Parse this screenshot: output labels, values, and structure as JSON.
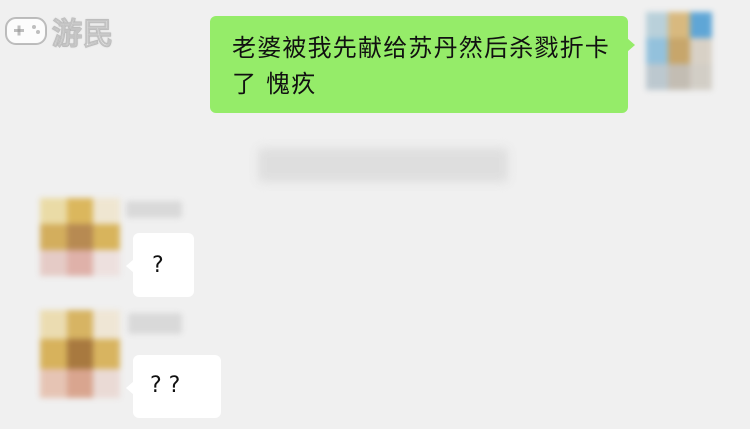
{
  "watermark": {
    "text": "游民",
    "icon": "gamepad-icon"
  },
  "colors": {
    "background": "#f0f0f0",
    "outgoing_bubble": "#95ec69",
    "incoming_bubble": "#ffffff"
  },
  "messages": [
    {
      "sender": "self",
      "text": "老婆被我先献给苏丹然后杀戮折卡了 愧疚",
      "avatar_mosaic": [
        "#b9d0da",
        "#d8b97f",
        "#5fa6d6",
        "#93c1dc",
        "#c7a66b",
        "#d8d1c6",
        "#bcc8cf",
        "#c3bdb3",
        "#d2cec6"
      ]
    },
    {
      "sender": "other",
      "text": "?",
      "avatar_mosaic": [
        "#eadba6",
        "#dbb75d",
        "#efe6d1",
        "#d3ae5d",
        "#b78a52",
        "#d8b45c",
        "#e5cbc6",
        "#dfb1a9",
        "#ede0de"
      ]
    },
    {
      "sender": "other",
      "text": "? ?",
      "avatar_mosaic": [
        "#ebdcb1",
        "#d7b463",
        "#efe6d5",
        "#d7b25c",
        "#a8793f",
        "#d8b460",
        "#e6c4b4",
        "#d9a58f",
        "#eadad5"
      ]
    }
  ]
}
